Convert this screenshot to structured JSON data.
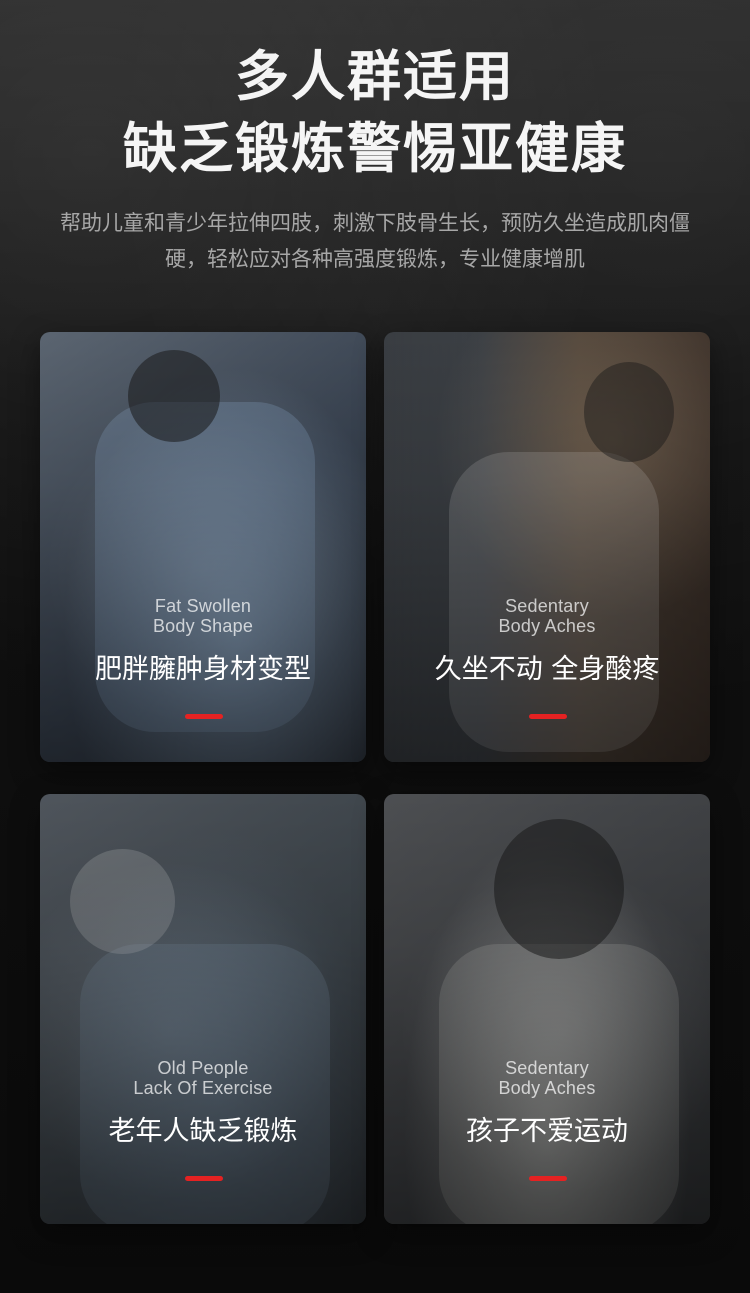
{
  "header": {
    "title_line1": "多人群适用",
    "title_line2": "缺乏锻炼警惕亚健康",
    "subtitle": "帮助儿童和青少年拉伸四肢，刺激下肢骨生长，预防久坐造成肌肉僵硬，轻松应对各种高强度锻炼，专业健康增肌"
  },
  "cards": [
    {
      "en_line1": "Fat Swollen",
      "en_line2": "Body Shape",
      "cn": "肥胖臃肿身材变型"
    },
    {
      "en_line1": "Sedentary",
      "en_line2": "Body Aches",
      "cn": "久坐不动 全身酸疼"
    },
    {
      "en_line1": "Old People",
      "en_line2": "Lack Of Exercise",
      "cn": "老年人缺乏锻炼"
    },
    {
      "en_line1": "Sedentary",
      "en_line2": "Body Aches",
      "cn": "孩子不爱运动"
    }
  ],
  "colors": {
    "accent": "#e52222",
    "background": "#0c0c0c",
    "title": "#f5f5f5",
    "subtitle": "#a7a7a7"
  }
}
